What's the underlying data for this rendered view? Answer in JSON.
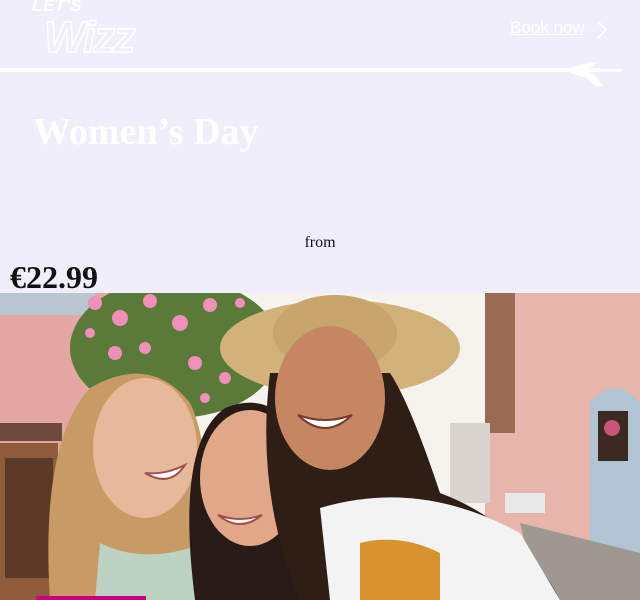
{
  "header": {
    "logo_tagline": "LET'S",
    "logo_wordmark": "WIZZ",
    "book_now": "Book now"
  },
  "hero": {
    "title": "Women’s Day",
    "from_label": "from",
    "price": "€22.99"
  },
  "colors": {
    "background": "#f0eefa",
    "accent": "#c6007e",
    "text_light": "#ffffff",
    "text_dark": "#111111"
  },
  "icons": {
    "chevron": "chevron-right-icon",
    "plane": "plane-icon"
  }
}
